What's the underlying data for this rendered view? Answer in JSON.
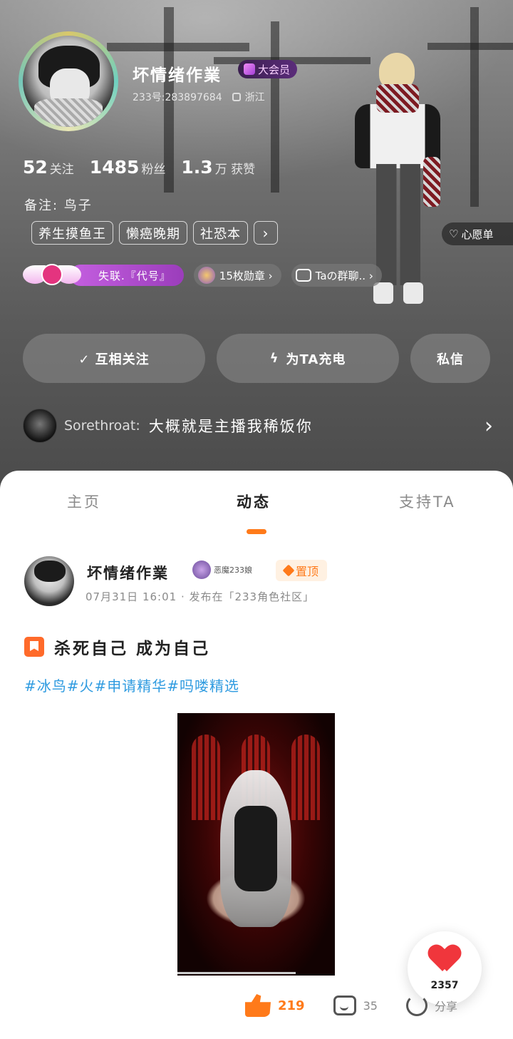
{
  "profile": {
    "username": "坏情绪作業",
    "vip_label": "大会员",
    "uid": "233号:283897684",
    "location": "浙江",
    "stats": [
      {
        "num": "52",
        "label": "关注"
      },
      {
        "num": "1485",
        "label": "粉丝"
      },
      {
        "num": "1.3",
        "label": "万 获赞"
      }
    ],
    "remark": "备注: 鸟子",
    "tags": [
      "养生摸鱼王",
      "懒癌晚期",
      "社恐本"
    ],
    "tag_more": "›",
    "wishlist": "心愿单",
    "couple_label": "失联.『代号』",
    "medals": "15枚勋章 ›",
    "group_chat": "Taの群聊.. ›"
  },
  "buttons": {
    "follow": "✓  互相关注",
    "charge": "为TA充电",
    "message": "私信"
  },
  "notice": {
    "name": "Sorethroat:",
    "text": "大概就是主播我稀饭你",
    "chevron": "›"
  },
  "tabs": [
    {
      "label": "主页"
    },
    {
      "label": "动态"
    },
    {
      "label": "支持TA"
    }
  ],
  "post": {
    "author": "坏情绪作業",
    "badge_text": "恶魔233娘",
    "pin_label": "置顶",
    "meta": "07月31日  16:01 · 发布在「233角色社区」",
    "title": "杀死自己 成为自己",
    "hashtags": [
      "#冰鸟",
      "#火",
      "#申请精华",
      "#吗喽精选"
    ],
    "fab_count": "2357",
    "likes": "219",
    "comments": "35",
    "share": "分享"
  },
  "colors": {
    "accent": "#ff7a1a",
    "hashtag": "#2f9be0",
    "heart": "#f0363c"
  }
}
